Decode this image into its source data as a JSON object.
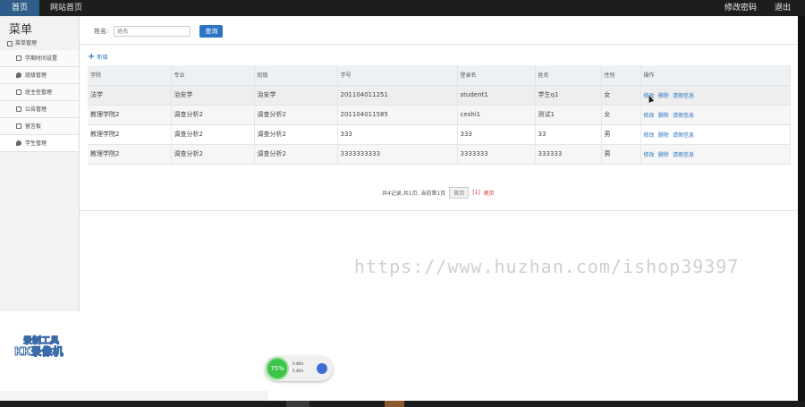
{
  "topnav": {
    "items": [
      "首页",
      "网站首页"
    ],
    "right": [
      "修改密码",
      "退出"
    ]
  },
  "sidebar": {
    "title": "菜单",
    "group": "菜单管理",
    "items": [
      "学期时间设置",
      "班级管理",
      "班主任管理",
      "公告管理",
      "留言板",
      "学生管理"
    ]
  },
  "search": {
    "label": "姓名:",
    "placeholder": "姓名",
    "button": "查询"
  },
  "toolbar": {
    "add_label": "新增"
  },
  "table": {
    "headers": [
      "学院",
      "专业",
      "班级",
      "学号",
      "登录名",
      "姓名",
      "性别",
      "操作"
    ],
    "rows": [
      [
        "法学",
        "治安学",
        "治安学",
        "201104011251",
        "student1",
        "学生q1",
        "女"
      ],
      [
        "教理学院2",
        "调查分析2",
        "调查分析2",
        "201104011585",
        "ceshi1",
        "测试1",
        "女"
      ],
      [
        "教理学院2",
        "调查分析2",
        "调查分析2",
        "333",
        "333",
        "33",
        "男"
      ],
      [
        "教理学院2",
        "调查分析2",
        "调查分析2",
        "3333333333",
        "3333333",
        "333333",
        "男"
      ]
    ],
    "actions": [
      "修改",
      "删除",
      "请假信息"
    ]
  },
  "pager": {
    "summary": "共4记录,共1页, 当前第1页",
    "first": "首页",
    "current": "[1]",
    "last": "尾页"
  },
  "overlay": {
    "watermark": "https://www.huzhan.com/ishop39397",
    "recorder_line1": "录制工具",
    "recorder_line2": "KK录像机",
    "meter_percent": "75%",
    "meter_up": "0.4K/s",
    "meter_down": "0.4K/s"
  },
  "colors": {
    "topbar": "#1d1d1d",
    "accent": "#2d74c4",
    "active_tab": "#2e5d8a",
    "danger": "#dd3333"
  }
}
